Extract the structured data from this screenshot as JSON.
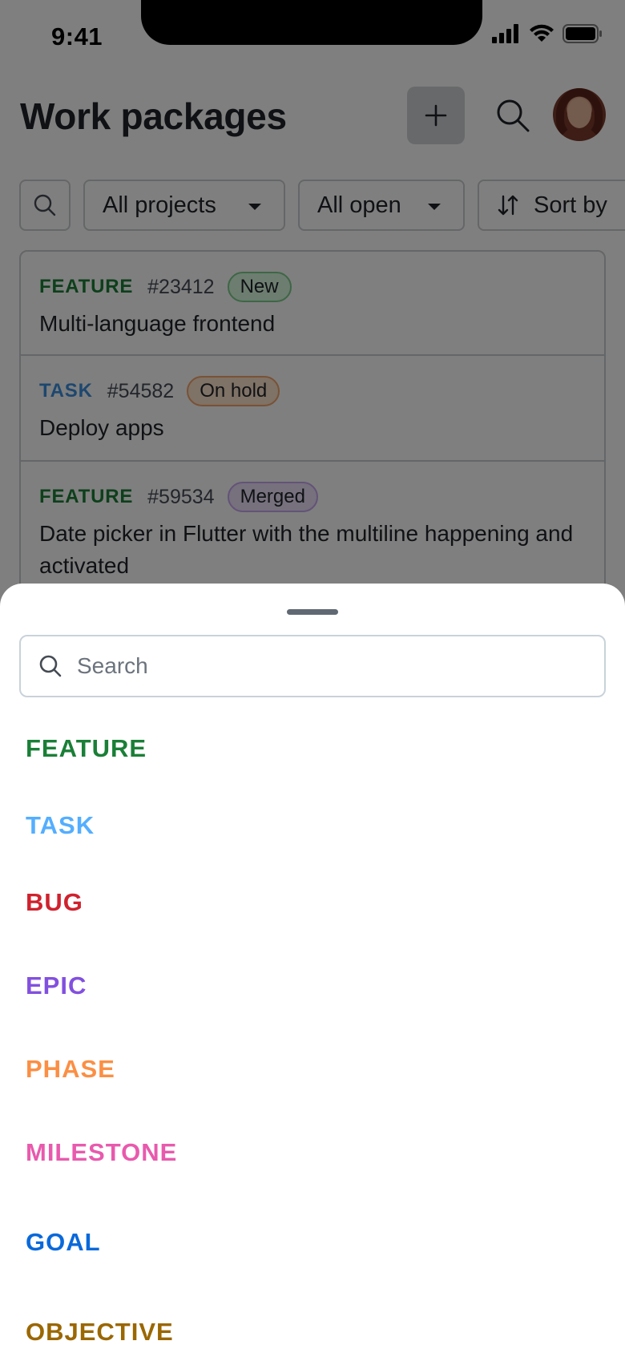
{
  "status_bar": {
    "time": "9:41"
  },
  "header": {
    "title": "Work packages"
  },
  "filters": {
    "projects_label": "All projects",
    "open_label": "All open",
    "sort_label": "Sort by"
  },
  "work_packages": [
    {
      "type": "FEATURE",
      "type_color": "#1a7f37",
      "id": "#23412",
      "status": "New",
      "status_bg": "#dafbe1",
      "status_border": "#7ccd8d",
      "subject": "Multi-language frontend"
    },
    {
      "type": "TASK",
      "type_color": "#3b8fde",
      "id": "#54582",
      "status": "On hold",
      "status_bg": "#ffe4cc",
      "status_border": "#f3a46a",
      "subject": "Deploy apps"
    },
    {
      "type": "FEATURE",
      "type_color": "#1a7f37",
      "id": "#59534",
      "status": "Merged",
      "status_bg": "#ece2fb",
      "status_border": "#c7a6f0",
      "subject": "Date picker in Flutter with the multiline happening and activated"
    }
  ],
  "sheet": {
    "search_placeholder": "Search",
    "type_options": [
      {
        "label": "FEATURE",
        "color": "#1a7f37"
      },
      {
        "label": "TASK",
        "color": "#54aeff"
      },
      {
        "label": "BUG",
        "color": "#cf222e"
      },
      {
        "label": "EPIC",
        "color": "#8250df"
      },
      {
        "label": "PHASE",
        "color": "#fb8f44"
      },
      {
        "label": "MILESTONE",
        "color": "#e85aad"
      },
      {
        "label": "GOAL",
        "color": "#0969da"
      },
      {
        "label": "OBJECTIVE",
        "color": "#9a6700"
      }
    ]
  }
}
